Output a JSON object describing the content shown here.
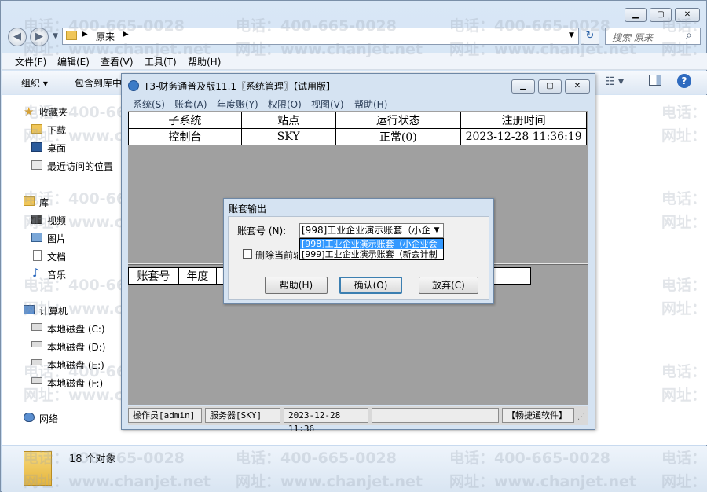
{
  "explorer": {
    "address": "原来",
    "search_placeholder": "搜索 原来",
    "menu": [
      "文件(F)",
      "编辑(E)",
      "查看(V)",
      "工具(T)",
      "帮助(H)"
    ],
    "toolbar": {
      "organize": "组织",
      "include": "包含到库中"
    },
    "nav": {
      "favorites": "收藏夹",
      "downloads": "下载",
      "desktop": "桌面",
      "recent": "最近访问的位置",
      "libraries": "库",
      "videos": "视频",
      "pictures": "图片",
      "documents": "文档",
      "music": "音乐",
      "computer": "计算机",
      "disk_c": "本地磁盘 (C:)",
      "disk_d": "本地磁盘 (D:)",
      "disk_e": "本地磁盘 (E:)",
      "disk_f": "本地磁盘 (F:)",
      "network": "网络"
    },
    "status": "18 个对象"
  },
  "watermark": {
    "phone": "电话：400-665-0028",
    "site": "网址：www.chanjet.net",
    "phone_short": "电话：",
    "site_short": "网址："
  },
  "t3": {
    "title": "T3-财务通普及版11.1〖系统管理〗【试用版】",
    "menu": [
      "系统(S)",
      "账套(A)",
      "年度账(Y)",
      "权限(O)",
      "视图(V)",
      "帮助(H)"
    ],
    "grid1": {
      "headers": [
        "子系统",
        "站点",
        "运行状态",
        "注册时间"
      ],
      "row": [
        "控制台",
        "SKY",
        "正常(0)",
        "2023-12-28 11:36:19"
      ]
    },
    "grid2": {
      "headers": [
        "账套号",
        "年度"
      ]
    },
    "status": {
      "operator": "操作员[admin]",
      "server": "服务器[SKY]",
      "time": "2023-12-28 11:36",
      "brand": "【畅捷通软件】"
    }
  },
  "dialog": {
    "title": "账套输出",
    "account_label": "账套号 (N):",
    "account_value": "[998]工业企业演示账套（小企",
    "options": [
      "[998]工业企业演示账套（小企业会",
      "[999]工业企业演示账套（新会计制"
    ],
    "delete_label": "删除当前输出账套",
    "help": "帮助(H)",
    "ok": "确认(O)",
    "cancel": "放弃(C)"
  },
  "colors": {
    "selection": "#3399ff",
    "grid_bg": "#a0a0a0",
    "chrome": "#d5e3f2"
  }
}
